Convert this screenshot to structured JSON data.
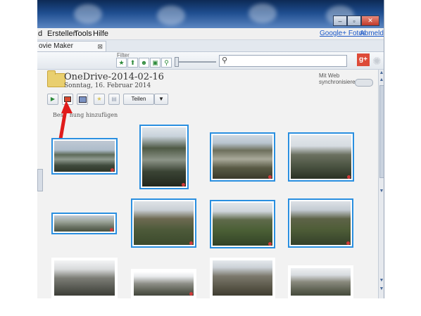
{
  "menu": {
    "item1": "d",
    "item2": "Erstellen",
    "item3": "Tools",
    "item4": "Hilfe",
    "google_photos": "Google+ Fotos",
    "logout": "Abmelden"
  },
  "tab": {
    "label": "ovie Maker",
    "close_icon": "close-icon"
  },
  "toolbar": {
    "filter_label": "Filter",
    "filter_icons": [
      "star-icon",
      "upload-icon",
      "person-icon",
      "film-icon",
      "pin-icon"
    ],
    "search_icon": "search-icon",
    "search_value": "",
    "gplus_label": "g+"
  },
  "album": {
    "title": "OneDrive-2014-02-16",
    "date": "Sonntag, 16. Februar 2014",
    "sync_label": "Mit Web synchronisieren",
    "share_label": "Teilen",
    "caption_hint": "Beschreibung hinzufügen",
    "caption_visible_start": "Bes",
    "caption_visible_end": "hung hinzufügen"
  },
  "actions": {
    "icons": [
      "play-icon",
      "slideshow-icon",
      "collage-icon",
      "star-icon",
      "save-icon",
      "chevron-down-icon"
    ]
  },
  "colors": {
    "accent_border": "#2a8fe0",
    "arrow_red": "#e01b1b",
    "title_bar": "#1e4d8f"
  }
}
